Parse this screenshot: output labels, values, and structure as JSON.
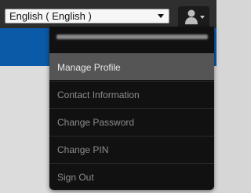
{
  "language_selector": {
    "selected": "English ( English )",
    "icon": "chevron-down-icon"
  },
  "user_menu": {
    "button_icon": "user-icon",
    "dropdown_icon": "chevron-down-icon",
    "items": [
      {
        "label": "Manage Profile",
        "active": true
      },
      {
        "label": "Contact Information",
        "active": false
      },
      {
        "label": "Change Password",
        "active": false
      },
      {
        "label": "Change PIN",
        "active": false
      },
      {
        "label": "Sign Out",
        "active": false
      }
    ]
  }
}
